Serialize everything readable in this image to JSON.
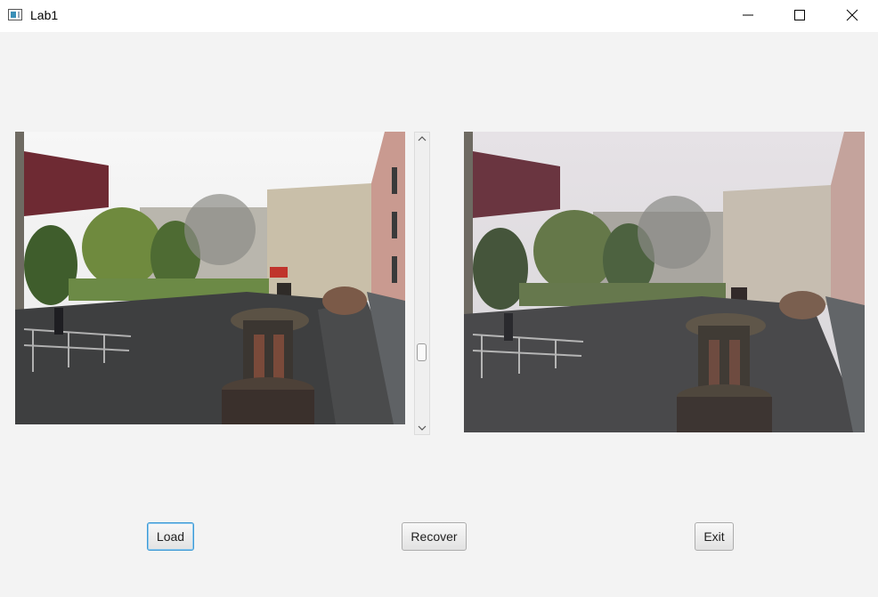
{
  "window": {
    "title": "Lab1",
    "controls": [
      "minimize",
      "maximize",
      "close"
    ]
  },
  "images": {
    "original": "original-courtyard-photo",
    "noisy": "noisy-courtyard-photo"
  },
  "buttons": {
    "load": "Load",
    "recover": "Recover",
    "exit": "Exit"
  },
  "icons": [
    "app-icon",
    "minimize-icon",
    "maximize-icon",
    "close-icon",
    "chevron-up-icon",
    "chevron-down-icon"
  ]
}
